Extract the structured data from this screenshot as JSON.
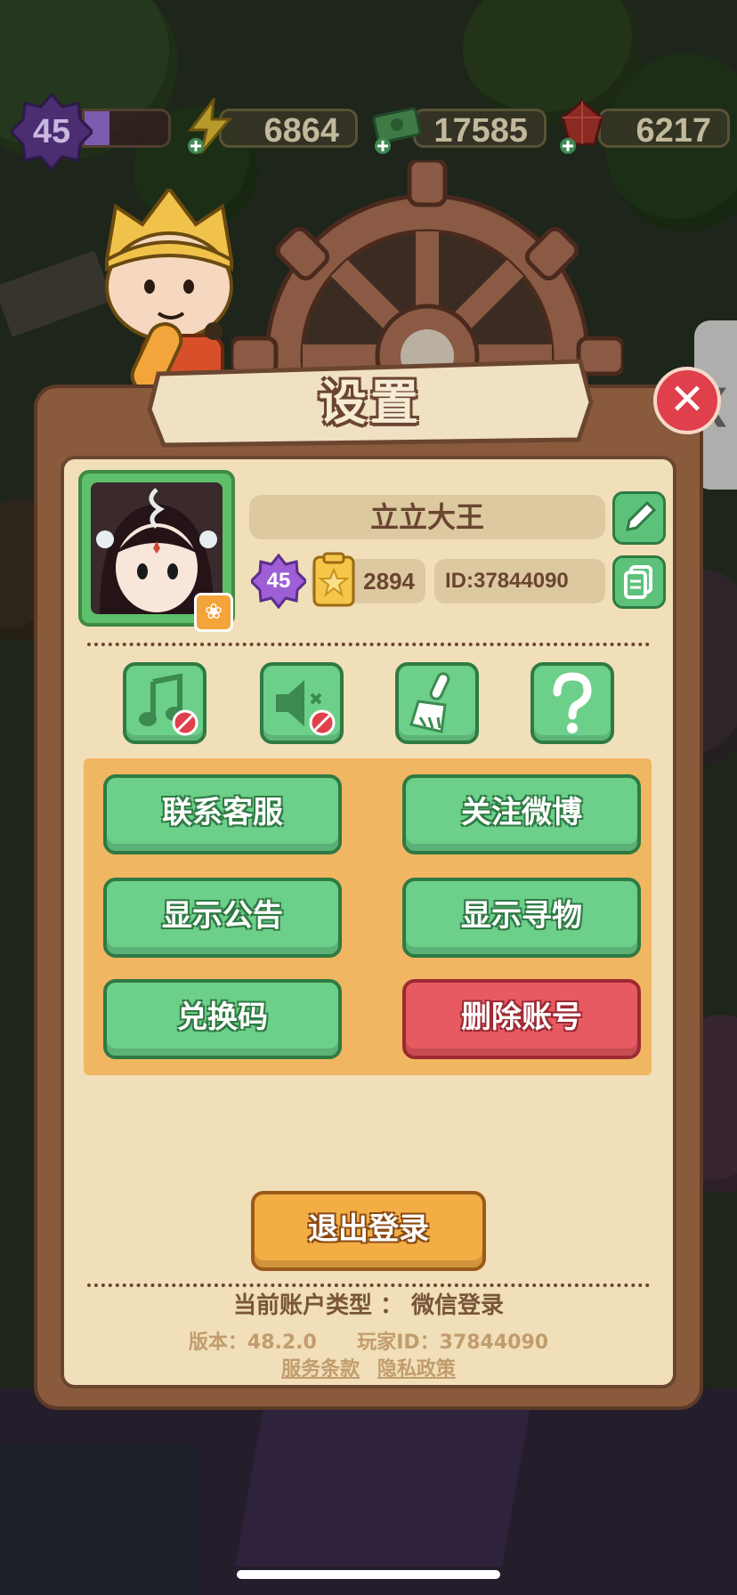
{
  "hud": {
    "level": "45",
    "xp_progress": 0.3,
    "energy": "6864",
    "cash": "17585",
    "gems": "6217"
  },
  "dialog": {
    "title": "设置",
    "close_icon": "close-icon",
    "profile": {
      "name": "立立大王",
      "level": "45",
      "score": "2894",
      "player_id": "ID:37844090",
      "edit_icon": "pencil-icon",
      "copy_icon": "copy-icon",
      "outfit_icon": "hanger-icon"
    },
    "quick_settings": [
      {
        "name": "music-off-button",
        "icon": "music-muted-icon"
      },
      {
        "name": "sound-off-button",
        "icon": "speaker-muted-icon"
      },
      {
        "name": "clear-cache-button",
        "icon": "broom-icon"
      },
      {
        "name": "help-button",
        "icon": "question-icon"
      }
    ],
    "buttons": {
      "contact_support": "联系客服",
      "follow_weibo": "关注微博",
      "show_notice": "显示公告",
      "show_search": "显示寻物",
      "redeem_code": "兑换码",
      "delete_account": "删除账号",
      "logout": "退出登录"
    },
    "footer": {
      "account_type": "当前账户类型 ： 微信登录",
      "version": "版本：48.2.0",
      "player_id": "玩家ID：37844090",
      "terms": "服务条款",
      "privacy": "隐私政策"
    }
  },
  "colors": {
    "panel": "#8a5a3c",
    "panel_inner": "#f0dfb8",
    "green_button": "#6ccf8a",
    "red_button": "#e85a62",
    "orange_button": "#f3ad45",
    "grid_box": "#f1b662"
  }
}
